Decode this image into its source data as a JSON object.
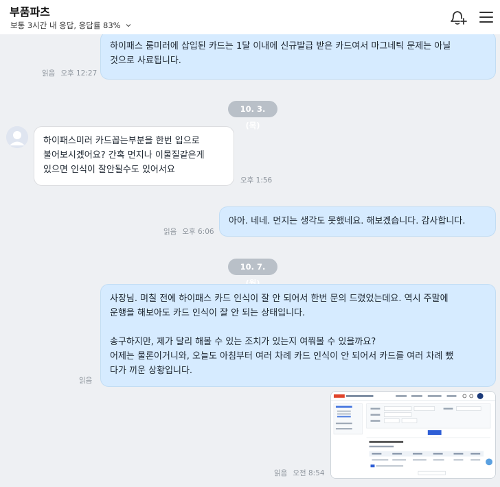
{
  "header": {
    "title": "부품파츠",
    "subtitle": "보통 3시간 내 응답, 응답률 83%"
  },
  "messages": {
    "m1": {
      "text": "하이패스 룸미러에 삽입된 카드는 1달 이내에 신규발급 받은 카드여서 마그네틱 문제는 아닐\n것으로 사료됩니다.",
      "read": "읽음",
      "time": "오후 12:27"
    },
    "date1": "10. 3.(목)",
    "m2": {
      "text": "하이패스미러 카드꼽는부분을 한번 입으로\n불어보시겠어요? 간혹 먼지나 이물질같은게\n있으면 인식이 잘안될수도 있어서요",
      "time": "오후 1:56"
    },
    "m3": {
      "text": "아아. 네네. 먼지는 생각도 못했네요. 해보겠습니다. 감사합니다.",
      "read": "읽음",
      "time": "오후 6:06"
    },
    "date2": "10. 7.(월)",
    "m4": {
      "text": "사장님. 며칠 전에 하이패스 카드 인식이 잘 안 되어서 한번 문의 드렸었는데요. 역시 주말에\n운행을 해보아도 카드 인식이 잘 안 되는 상태입니다.\n\n송구하지만, 제가 달리 해볼 수 있는 조치가 있는지 여쭤볼 수 있을까요?\n어제는 물론이거니와, 오늘도 아침부터 여러 차례 카드 인식이 안 되어서 카드를 여러 차례 뺐\n다가 끼운 상황입니다.",
      "read": "읽음"
    },
    "m5": {
      "read": "읽음",
      "time": "오전 8:54"
    }
  },
  "colors": {
    "outgoing_bubble": "#d6ebff",
    "incoming_bubble": "#ffffff",
    "background": "#eef0f3",
    "date_pill": "#b9c0c8"
  },
  "icons": {
    "notify": "bell-plus-icon",
    "menu": "hamburger-menu-icon"
  }
}
